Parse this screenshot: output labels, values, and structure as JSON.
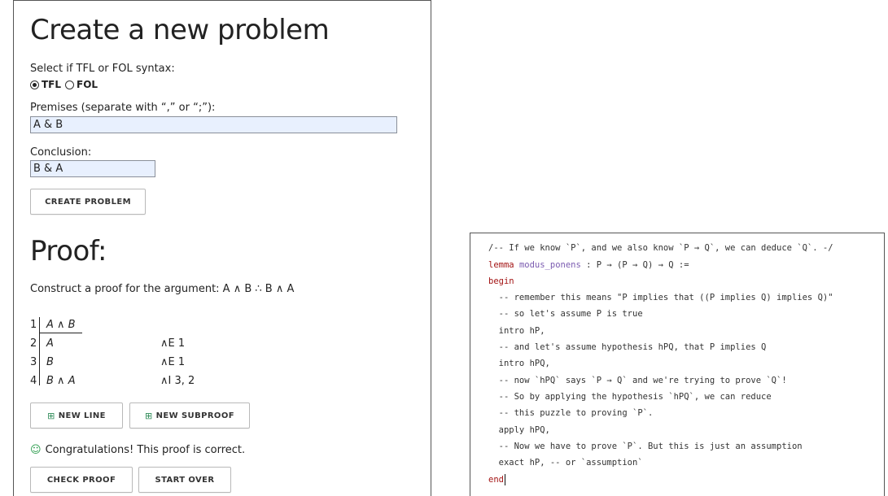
{
  "create": {
    "title": "Create a new problem",
    "syntax_label": "Select if TFL or FOL syntax:",
    "options": [
      "TFL",
      "FOL"
    ],
    "selected": "TFL",
    "premises_label": "Premises (separate with “,” or “;”):",
    "premises_value": "A & B",
    "conclusion_label": "Conclusion:",
    "conclusion_value": "B & A",
    "create_button": "CREATE PROBLEM"
  },
  "proof": {
    "title": "Proof:",
    "instruction": "Construct a proof for the argument: A ∧ B ∴ B ∧ A",
    "lines": [
      {
        "num": "1",
        "formula": "A ∧ B",
        "justification": ""
      },
      {
        "num": "2",
        "formula": "A",
        "justification": "∧E 1"
      },
      {
        "num": "3",
        "formula": "B",
        "justification": "∧E 1"
      },
      {
        "num": "4",
        "formula": "B ∧ A",
        "justification": "∧I 3, 2"
      }
    ],
    "new_line_button": "NEW LINE",
    "new_subproof_button": "NEW SUBPROOF",
    "status": "Congratulations! This proof is correct.",
    "check_button": "CHECK PROOF",
    "start_over_button": "START OVER"
  },
  "code": {
    "lines": [
      "/-- If we know `P`, and we also know `P → Q`, we can deduce `Q`. -/",
      "lemma modus_ponens : P → (P → Q) → Q :=",
      "begin",
      "  -- remember this means \"P implies that ((P implies Q) implies Q)\"",
      "  -- so let's assume P is true",
      "  intro hP,",
      "  -- and let's assume hypothesis hPQ, that P implies Q",
      "  intro hPQ,",
      "  -- now `hPQ` says `P → Q` and we're trying to prove `Q`!",
      "  -- So by applying the hypothesis `hPQ`, we can reduce",
      "  -- this puzzle to proving `P`.",
      "  apply hPQ,",
      "  -- Now we have to prove `P`. But this is just an assumption",
      "  exact hP, -- or `assumption`",
      "end"
    ],
    "keyword_color": "#a31515",
    "name_color": "#7b5bb0"
  }
}
